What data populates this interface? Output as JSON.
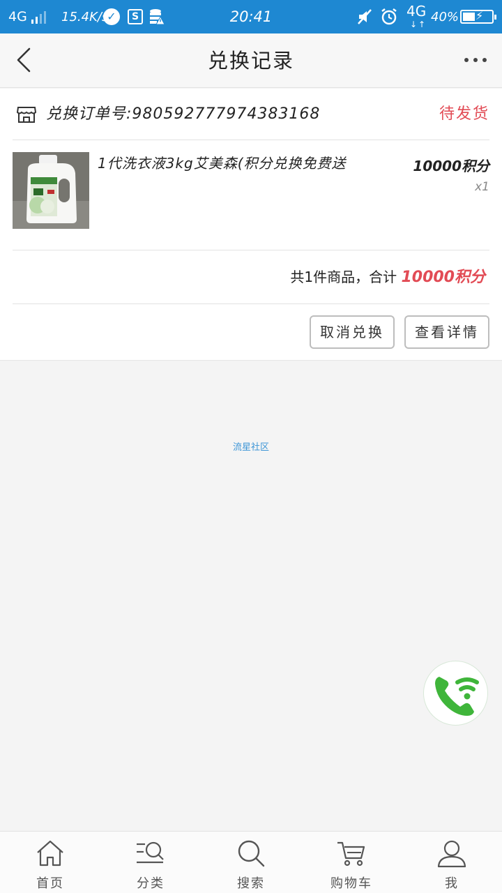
{
  "status_bar": {
    "network": "4G",
    "speed": "15.4K/s",
    "time": "20:41",
    "network2": "4G",
    "battery": "40%"
  },
  "header": {
    "title": "兑换记录"
  },
  "order": {
    "order_number_label": "兑换订单号:980592777974383168",
    "status": "待发货",
    "product": {
      "name": "1代洗衣液3kg艾美森(积分兑换免费送",
      "price": "10000积分",
      "quantity": "x1"
    },
    "summary_prefix": "共1件商品，合计",
    "summary_points": "10000积分",
    "actions": {
      "cancel": "取消兑换",
      "detail": "查看详情"
    }
  },
  "watermark": "流星社区",
  "tabbar": {
    "items": [
      {
        "label": "首页",
        "icon": "home-icon"
      },
      {
        "label": "分类",
        "icon": "category-icon"
      },
      {
        "label": "搜索",
        "icon": "search-icon"
      },
      {
        "label": "购物车",
        "icon": "cart-icon"
      },
      {
        "label": "我",
        "icon": "user-icon"
      }
    ]
  },
  "colors": {
    "status_bar": "#1e88d2",
    "accent_red": "#e24b55",
    "link_blue": "#3d95d6",
    "phone_green": "#3fb53a"
  }
}
